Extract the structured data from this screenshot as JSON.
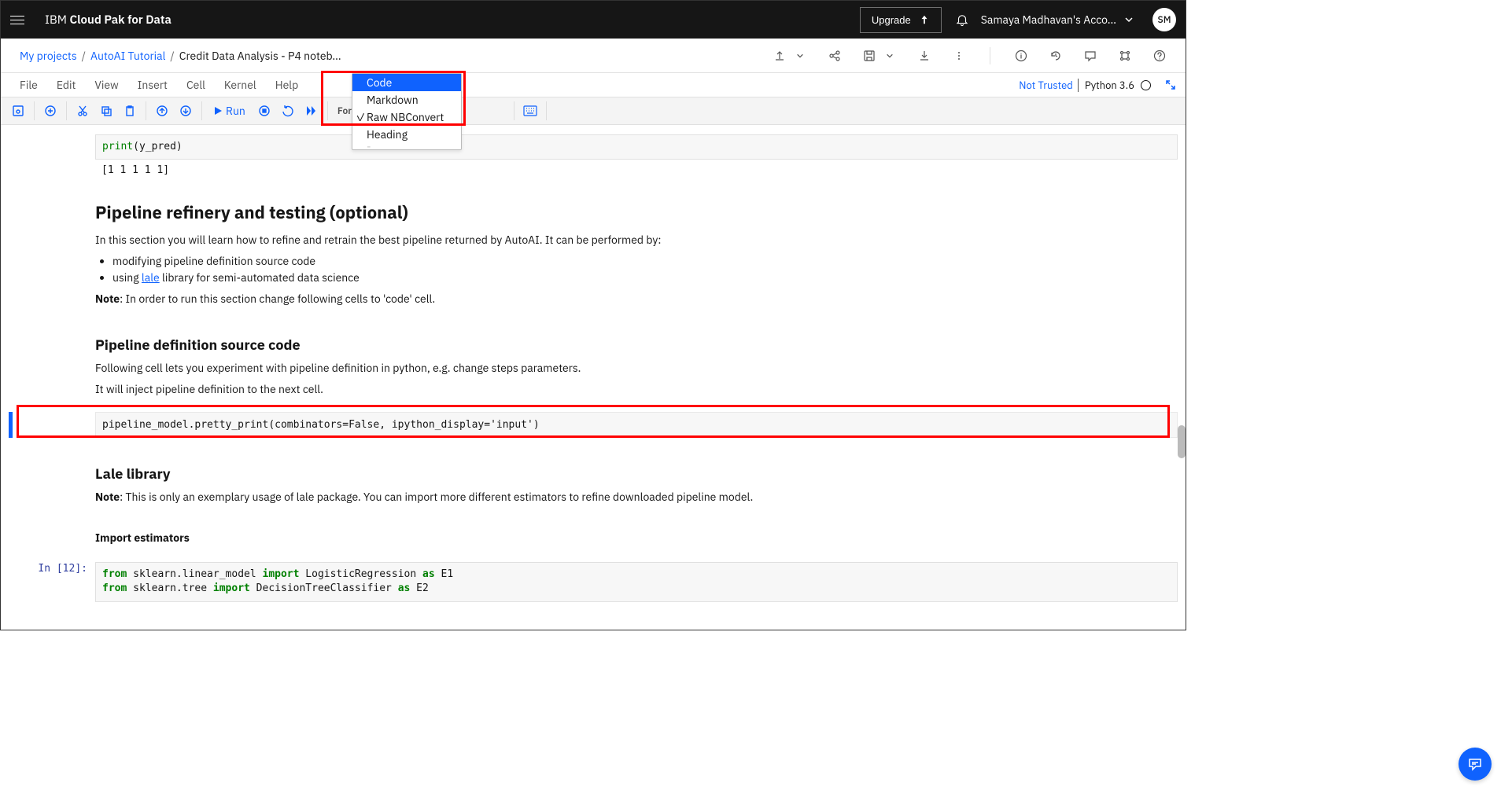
{
  "header": {
    "brand_prefix": "IBM ",
    "brand_bold": "Cloud Pak for Data",
    "upgrade": "Upgrade",
    "account": "Samaya Madhavan's Acco…",
    "avatar": "SM"
  },
  "breadcrumbs": {
    "items": [
      "My projects",
      "AutoAI Tutorial",
      "Credit Data Analysis - P4 noteb…"
    ]
  },
  "menus": [
    "File",
    "Edit",
    "View",
    "Insert",
    "Cell",
    "Kernel",
    "Help"
  ],
  "kernel": {
    "trust": "Not Trusted",
    "name": "Python 3.6"
  },
  "toolbar": {
    "run": "Run",
    "format": "Format"
  },
  "dropdown": {
    "items": [
      {
        "label": "Code",
        "highlighted": true,
        "checked": false
      },
      {
        "label": "Markdown",
        "highlighted": false,
        "checked": false
      },
      {
        "label": "Raw NBConvert",
        "highlighted": false,
        "checked": true
      },
      {
        "label": "Heading",
        "highlighted": false,
        "checked": false
      }
    ]
  },
  "cells": {
    "c0_code": "print(y_pred)",
    "c0_out": "[1 1 1 1 1]",
    "md1_h": "Pipeline refinery and testing (optional)",
    "md1_p1": "In this section you will learn how to refine and retrain the best pipeline returned by AutoAI. It can be performed by:",
    "md1_li1": "modifying pipeline definition source code",
    "md1_li2a": "using ",
    "md1_li2_link": "lale",
    "md1_li2b": " library for semi-automated data science",
    "md1_note_b": "Note",
    "md1_note": ": In order to run this section change following cells to 'code' cell.",
    "md2_h": "Pipeline definition source code",
    "md2_p1": "Following cell lets you experiment with pipeline definition in python, e.g. change steps parameters.",
    "md2_p2": "It will inject pipeline definition to the next cell.",
    "raw1": "pipeline_model.pretty_print(combinators=False, ipython_display='input')",
    "md3_h": "Lale library",
    "md3_note_b": "Note",
    "md3_p": ": This is only an exemplary usage of lale package. You can import more different estimators to refine downloaded pipeline model.",
    "md4_h": "Import estimators",
    "c12_prompt": "In [12]:",
    "c12_line1_a": "from",
    "c12_line1_b": " sklearn.linear_model ",
    "c12_line1_c": "import",
    "c12_line1_d": " LogisticRegression ",
    "c12_line1_e": "as",
    "c12_line1_f": " E1",
    "c12_line2_a": "from",
    "c12_line2_b": " sklearn.tree ",
    "c12_line2_c": "import",
    "c12_line2_d": " DecisionTreeClassifier ",
    "c12_line2_e": "as",
    "c12_line2_f": " E2"
  }
}
